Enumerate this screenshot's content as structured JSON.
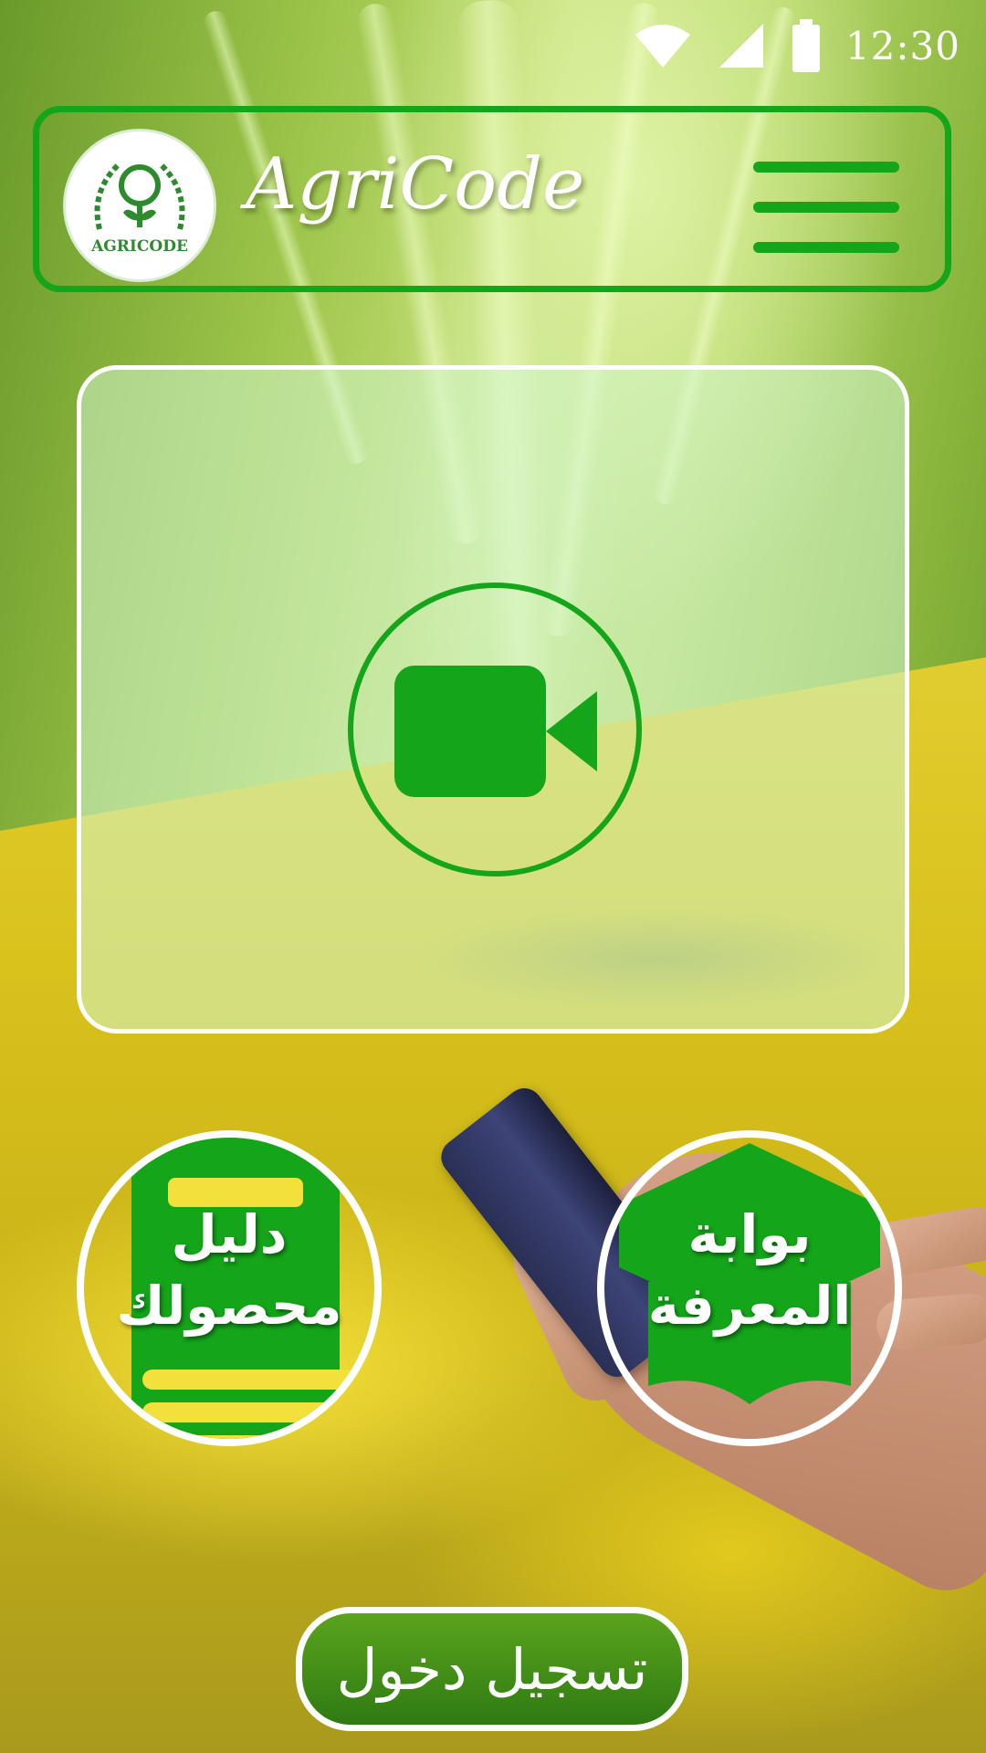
{
  "status_bar": {
    "time": "12:30",
    "icons": [
      "wifi-icon",
      "signal-icon",
      "battery-icon"
    ]
  },
  "header": {
    "app_title": "AgriCode",
    "logo_text": "AGRICODE",
    "menu_icon": "hamburger-menu-icon"
  },
  "video": {
    "icon": "video-camera-icon"
  },
  "crop_guide": {
    "label_line1": "دليل",
    "label_line2": "محصولك",
    "icon": "book-icon"
  },
  "knowledge_portal": {
    "label_line1": "بوابة",
    "label_line2": "المعرفة",
    "icon": "graduation-cap-icon"
  },
  "login": {
    "label": "تسجيل دخول"
  },
  "colors": {
    "accent_green": "#14a51a",
    "white": "#ffffff"
  }
}
